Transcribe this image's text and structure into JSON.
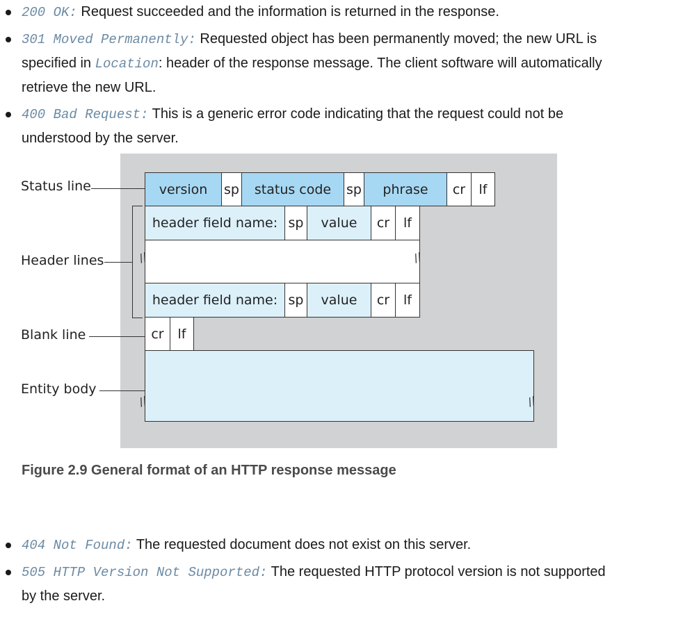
{
  "bullets_top": [
    {
      "code": "200 OK:",
      "text": " Request succeeded and the information is returned in the response."
    },
    {
      "code": "301 Moved Permanently:",
      "text": " Requested object has been permanently moved; the new URL is",
      "line2_prefix": "specified in ",
      "line2_code": "Location",
      "line2_suffix": ": header of the response message. The client software will automatically",
      "line3": "retrieve the new URL."
    },
    {
      "code": "400 Bad Request:",
      "text": " This is a generic error code indicating that the request could not be",
      "line2": "understood by the server."
    }
  ],
  "figure": {
    "labels": {
      "status_line": "Status line",
      "header_lines": "Header lines",
      "blank_line": "Blank line",
      "entity_body": "Entity body"
    },
    "status_row": {
      "version": "version",
      "sp1": "sp",
      "status_code": "status code",
      "sp2": "sp",
      "phrase": "phrase",
      "cr": "cr",
      "lf": "lf"
    },
    "header_row": {
      "name": "header field name:",
      "sp": "sp",
      "value": "value",
      "cr": "cr",
      "lf": "lf"
    },
    "blank_row": {
      "cr": "cr",
      "lf": "lf"
    },
    "break_mark": "//"
  },
  "caption": "Figure 2.9 General format of an HTTP response message",
  "bullets_bottom": [
    {
      "code": "404 Not Found:",
      "text": " The requested document does not exist on this server."
    },
    {
      "code": "505 HTTP Version Not Supported:",
      "text": " The requested HTTP protocol version is not supported",
      "line2": "by the server."
    }
  ]
}
